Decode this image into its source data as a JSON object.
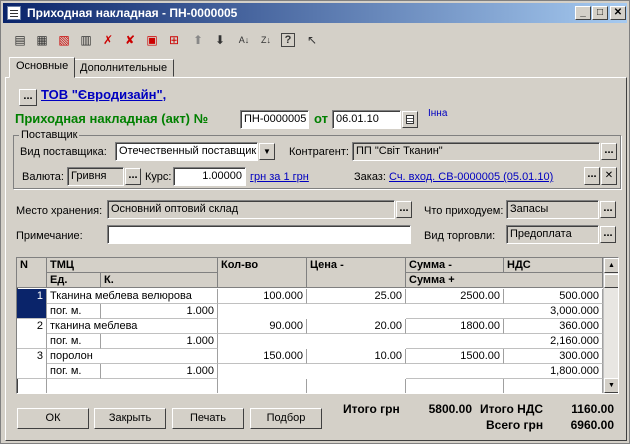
{
  "window": {
    "title": "Приходная накладная - ПН-0000005",
    "controls": {
      "minimize": "_",
      "maximize": "□",
      "close": "✕"
    }
  },
  "toolbar_icons": [
    "new-row-icon",
    "copy-row-icon",
    "delete-row-icon",
    "edit-row-icon",
    "mark-delete-icon",
    "delete-icon",
    "form-icon",
    "move-icon",
    "move-up-icon",
    "move-down-icon",
    "sort-asc-icon",
    "sort-desc-icon",
    "help-icon",
    "context-help-icon"
  ],
  "tabs": [
    {
      "label": "Основные",
      "active": true
    },
    {
      "label": "Дополнительные",
      "active": false
    }
  ],
  "company": {
    "name": "ТОВ \"Євродизайн\","
  },
  "doc": {
    "heading": "Приходная накладная (акт) №",
    "number": "ПН-0000005",
    "from_label": "от",
    "date": "06.01.10",
    "user": "Інна"
  },
  "supplier": {
    "group_label": "Поставщик",
    "type_label": "Вид поставщика:",
    "type_value": "Отечественный поставщик",
    "contractor_label": "Контрагент:",
    "contractor_value": "ПП \"Світ Тканин\"",
    "currency_label": "Валюта:",
    "currency_value": "Гривня",
    "rate_label": "Курс:",
    "rate_value": "1.00000",
    "rate_link": "грн за 1 грн",
    "order_label": "Заказ:",
    "order_link": "Сч. вход. СВ-0000005 (05.01.10)"
  },
  "storage": {
    "label": "Место хранения:",
    "value": "Основний оптовий склад"
  },
  "incoming": {
    "label": "Что приходуем:",
    "value": "Запасы"
  },
  "note": {
    "label": "Примечание:",
    "value": ""
  },
  "trade": {
    "label": "Вид торговли:",
    "value": "Предоплата"
  },
  "table": {
    "headers": {
      "n": "N",
      "item": "ТМЦ",
      "unit": "Ед.",
      "k": "К.",
      "qty": "Кол-во",
      "price": "Цена -",
      "sum": "Сумма -",
      "vat": "НДС",
      "sum_plus": "Сумма +"
    },
    "rows": [
      {
        "n": "1",
        "item": "Тканина меблева велюрова",
        "unit": "пог. м.",
        "k": "1.000",
        "qty": "100.000",
        "price": "25.00",
        "sum": "2500.00",
        "vat": "500.000",
        "total": "3,000.000"
      },
      {
        "n": "2",
        "item": "тканина  меблева",
        "unit": "пог. м.",
        "k": "1.000",
        "qty": "90.000",
        "price": "20.00",
        "sum": "1800.00",
        "vat": "360.000",
        "total": "2,160.000"
      },
      {
        "n": "3",
        "item": "поролон",
        "unit": "пог. м.",
        "k": "1.000",
        "qty": "150.000",
        "price": "10.00",
        "sum": "1500.00",
        "vat": "300.000",
        "total": "1,800.000"
      }
    ]
  },
  "buttons": {
    "ok": "ОК",
    "close": "Закрыть",
    "print": "Печать",
    "select": "Подбор"
  },
  "totals": {
    "total_label": "Итого грн",
    "total_value": "5800.00",
    "vat_label": "Итого НДС",
    "vat_value": "1160.00",
    "grand_label": "Всего грн",
    "grand_value": "6960.00"
  }
}
